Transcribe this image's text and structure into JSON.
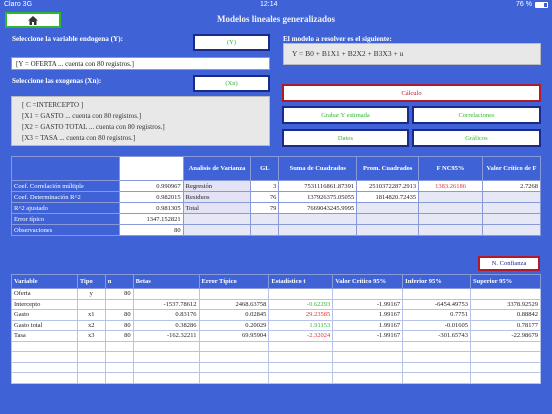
{
  "status": {
    "carrier": "Claro 3G",
    "time": "12:14",
    "battery": "76 %"
  },
  "header": {
    "home_icon": "home-icon",
    "title": "Modelos lineales generalizados"
  },
  "endog": {
    "label": "Seleccione la variable endogena (Y):",
    "button": "(Y)",
    "value": "[Y = OFERTA ... cuenta con 80 registros.]"
  },
  "model": {
    "label": "El modelo a resolver es el siguiente:",
    "equation": "Y = B0 + B1X1 + B2X2 + B3X3 + u"
  },
  "exog": {
    "label": "Seleccione las exogenas (Xn):",
    "button": "(Xn)",
    "items": [
      "[ C =INTERCEPTO ]",
      "[X1 = GASTO ... cuenta con 80 registros.]",
      "[X2 = GASTO TOTAL ... cuenta con 80 registros.]",
      "[X3 = TASA ... cuenta con 80 registros.]"
    ]
  },
  "actions": {
    "calc": "Cálculo",
    "save_y": "Grabar Y estimada",
    "correl": "Correlaciones",
    "data": "Datos",
    "graphs": "Gráficos",
    "confidence": "N. Confianza"
  },
  "summary": {
    "headers": [
      "Analisis de Varianza",
      "GL",
      "Suma de Cuadrados",
      "Prom. Cuadrados",
      "F NC95%",
      "Valor Crítico de F"
    ],
    "rows": [
      {
        "label": "Coef. Correlación múltiple",
        "value": "0.990967",
        "source": "Regresión",
        "gl": "3",
        "ss": "7531116861.87391",
        "ms": "2510372287.2913",
        "f": "1383.26186",
        "fc": "2.7268"
      },
      {
        "label": "Coef. Determinación R^2",
        "value": "0.982015",
        "source": "Residuos",
        "gl": "76",
        "ss": "137926375.05055",
        "ms": "1814820.72435",
        "f": "",
        "fc": ""
      },
      {
        "label": "R^2 ajustado",
        "value": "0.981305",
        "source": "Total",
        "gl": "79",
        "ss": "7669043245.9995",
        "ms": "",
        "f": "",
        "fc": ""
      },
      {
        "label": "Error típico",
        "value": "1347.152821",
        "source": "",
        "gl": "",
        "ss": "",
        "ms": "",
        "f": "",
        "fc": ""
      },
      {
        "label": "Observaciones",
        "value": "80",
        "source": "",
        "gl": "",
        "ss": "",
        "ms": "",
        "f": "",
        "fc": ""
      }
    ]
  },
  "coef": {
    "headers": [
      "Variable",
      "Tipo",
      "n",
      "Betas",
      "Error Típico",
      "Estadístico t",
      "Valor Crítico 95%",
      "Inferior 95%",
      "Superior 95%"
    ],
    "rows": [
      {
        "variable": "Oferta",
        "tipo": "y",
        "n": "80",
        "beta": "",
        "se": "",
        "t": "",
        "vc": "",
        "lo": "",
        "hi": "",
        "tc": ""
      },
      {
        "variable": "Intercepto",
        "tipo": "",
        "n": "",
        "beta": "-1537.78612",
        "se": "2468.63758",
        "t": "-0.62293",
        "vc": "-1.99167",
        "lo": "-6454.49753",
        "hi": "3378.92529",
        "tc": "grn"
      },
      {
        "variable": "Gasto",
        "tipo": "x1",
        "n": "80",
        "beta": "0.83176",
        "se": "0.02845",
        "t": "29.23585",
        "vc": "1.99167",
        "lo": "0.7751",
        "hi": "0.88842",
        "tc": "red"
      },
      {
        "variable": "Gasto total",
        "tipo": "x2",
        "n": "80",
        "beta": "0.38286",
        "se": "0.20029",
        "t": "1.91153",
        "vc": "1.99167",
        "lo": "-0.01605",
        "hi": "0.78177",
        "tc": "grn"
      },
      {
        "variable": "Tasa",
        "tipo": "x3",
        "n": "80",
        "beta": "-162.32211",
        "se": "69.95904",
        "t": "-2.32024",
        "vc": "-1.99167",
        "lo": "-301.65743",
        "hi": "-22.98679",
        "tc": "red"
      }
    ],
    "empty_rows": 4
  },
  "colors": {
    "background": "#3f63d6",
    "accent_green": "#2eb82e",
    "accent_red": "#b01a2a"
  }
}
